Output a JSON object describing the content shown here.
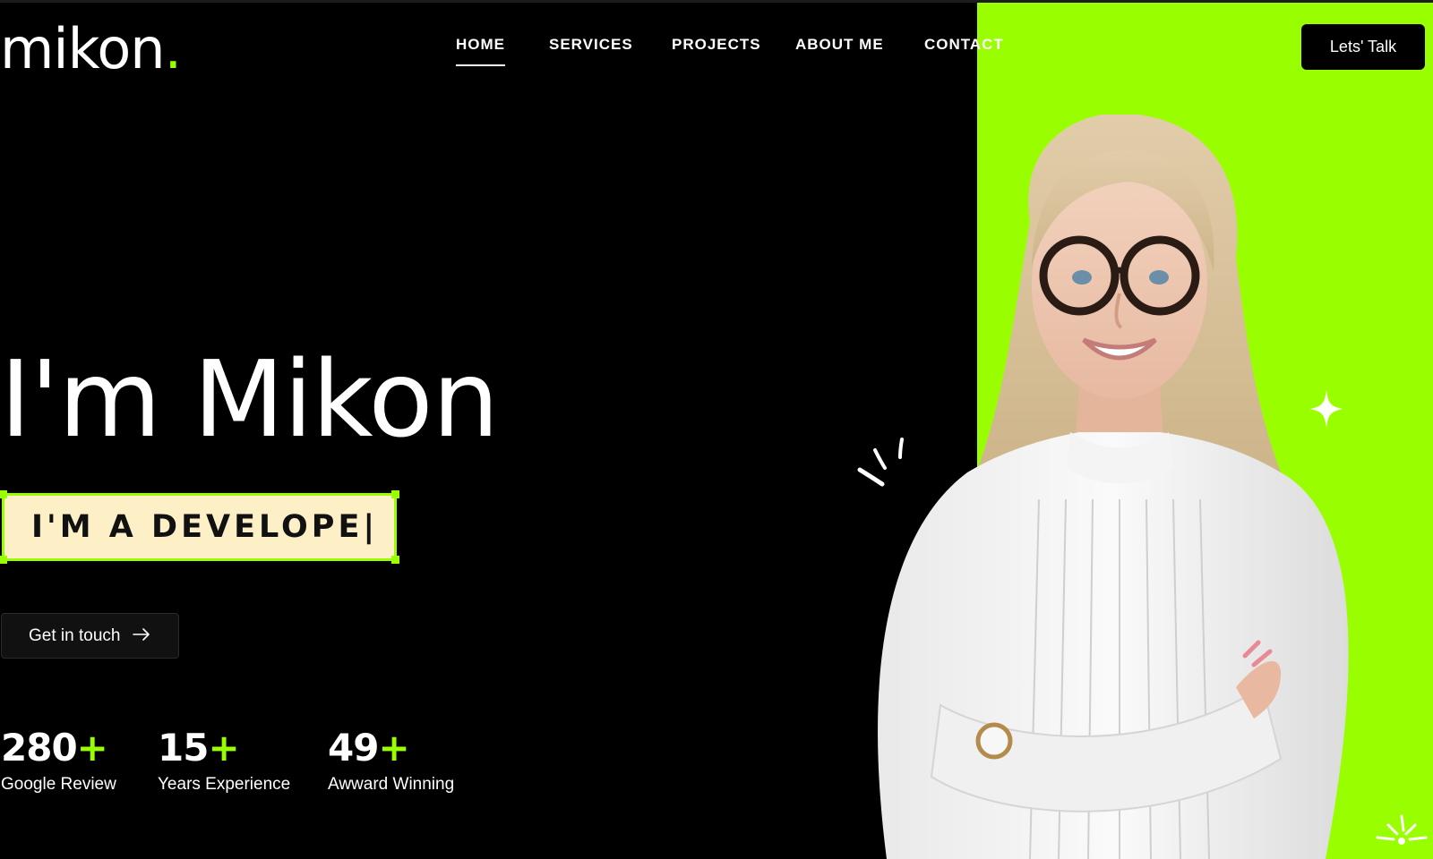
{
  "brand": {
    "name": "mikon",
    "dot": "."
  },
  "nav": {
    "items": [
      {
        "label": "HOME",
        "active": true
      },
      {
        "label": "SERVICES",
        "active": false
      },
      {
        "label": "PROJECTS",
        "active": false
      },
      {
        "label": "ABOUT ME",
        "active": false
      },
      {
        "label": "CONTACT",
        "active": false
      }
    ],
    "cta_label": "Lets' Talk"
  },
  "hero": {
    "title": "I'm Mikon",
    "typing_text": "I'M A DEVELOPE|",
    "cta_label": "Get in touch",
    "cta_icon": "arrow-right-icon"
  },
  "stats": [
    {
      "value": "280",
      "suffix": "+",
      "label": "Google Review"
    },
    {
      "value": "15",
      "suffix": "+",
      "label": "Years Experience"
    },
    {
      "value": "49",
      "suffix": "+",
      "label": "Awward Winning"
    }
  ],
  "colors": {
    "accent": "#99ff00",
    "background": "#000000",
    "highlight": "#fdf0c6"
  },
  "icons": [
    "sparkle-icon",
    "burst-lines-icon",
    "star-burst-icon"
  ]
}
